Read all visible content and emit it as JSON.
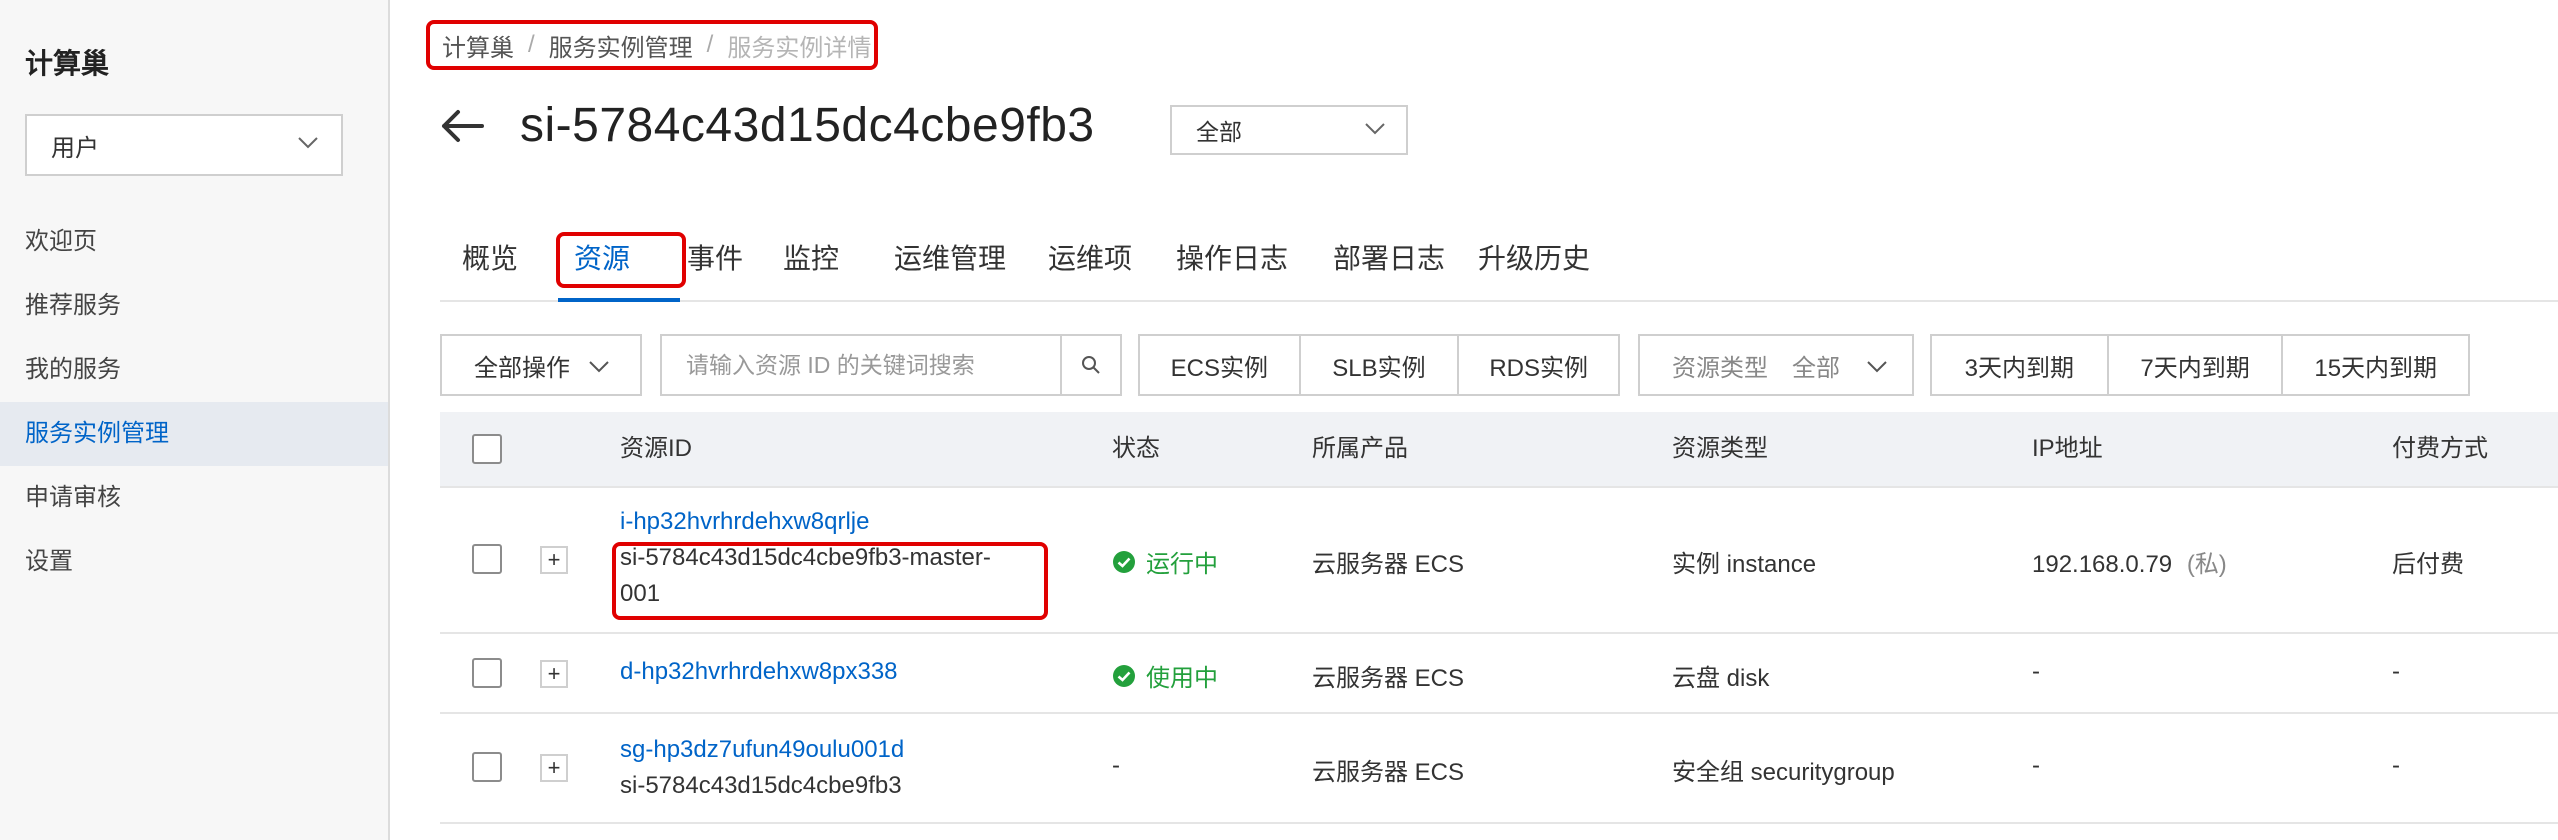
{
  "sidebar": {
    "title": "计算巢",
    "user_select": "用户",
    "items": [
      {
        "label": "欢迎页"
      },
      {
        "label": "推荐服务"
      },
      {
        "label": "我的服务"
      },
      {
        "label": "服务实例管理"
      },
      {
        "label": "申请审核"
      },
      {
        "label": "设置"
      }
    ]
  },
  "breadcrumb": [
    "计算巢",
    "服务实例管理",
    "服务实例详情"
  ],
  "page": {
    "title": "si-5784c43d15dc4cbe9fb3",
    "scope_select": "全部"
  },
  "tabs": [
    "概览",
    "资源",
    "事件",
    "监控",
    "运维管理",
    "运维项",
    "操作日志",
    "部署日志",
    "升级历史"
  ],
  "active_tab": "资源",
  "toolbar": {
    "bulk_actions": "全部操作",
    "search_placeholder": "请输入资源 ID 的关键词搜索",
    "instance_filters": [
      "ECS实例",
      "SLB实例",
      "RDS实例"
    ],
    "resource_type_label": "资源类型",
    "resource_type_value": "全部",
    "expiry_filters": [
      "3天内到期",
      "7天内到期",
      "15天内到期"
    ]
  },
  "table": {
    "headers": [
      "资源ID",
      "状态",
      "所属产品",
      "资源类型",
      "IP地址",
      "付费方式"
    ],
    "rows": [
      {
        "id": "i-hp32hvrhrdehxw8qrlje",
        "name_line1": "si-5784c43d15dc4cbe9fb3-master-",
        "name_line2": "001",
        "status": "运行中",
        "product": "云服务器 ECS",
        "type": "实例 instance",
        "ip": "192.168.0.79",
        "ip_tag": "(私)",
        "billing": "后付费"
      },
      {
        "id": "d-hp32hvrhrdehxw8px338",
        "status": "使用中",
        "product": "云服务器 ECS",
        "type": "云盘 disk",
        "ip": "-",
        "billing": "-"
      },
      {
        "id": "sg-hp3dz7ufun49oulu001d",
        "name_line1": "si-5784c43d15dc4cbe9fb3",
        "status": "-",
        "product": "云服务器 ECS",
        "type": "安全组 securitygroup",
        "ip": "-",
        "billing": "-"
      }
    ]
  },
  "colors": {
    "accent": "#0064c8",
    "success": "#23a03c",
    "highlight": "#e00000"
  }
}
